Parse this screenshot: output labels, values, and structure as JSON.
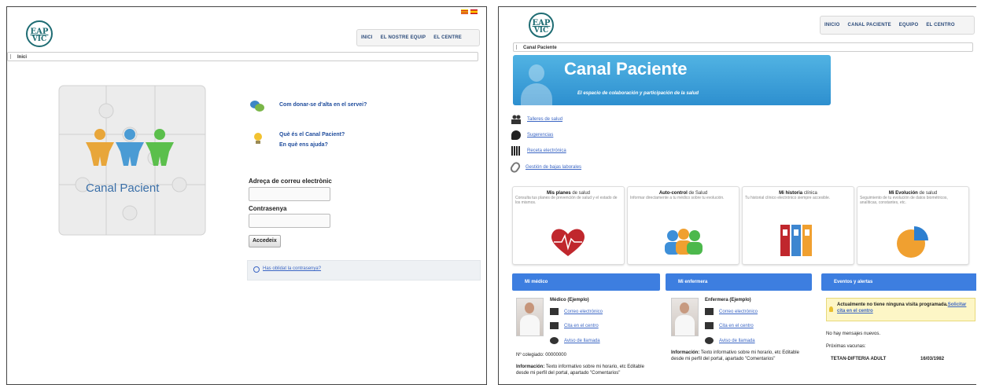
{
  "left": {
    "logo": {
      "line1": "EAP",
      "line2": "VIC"
    },
    "flags": [
      "catalan-flag",
      "spanish-flag"
    ],
    "nav": [
      "INICI",
      "EL NOSTRE EQUIP",
      "EL CENTRE"
    ],
    "breadcrumb": "Inici",
    "puzzle_text": "Canal Pacient",
    "links": [
      {
        "label": "Com donar-se d'alta en el servei?",
        "icon": "chat-bubbles-icon"
      },
      {
        "label": "Què és el Canal Pacient?",
        "icon": "lightbulb-icon"
      },
      {
        "label": "En què ens ajuda?",
        "icon": ""
      }
    ],
    "email_label": "Adreça de correu electrònic",
    "password_label": "Contrasenya",
    "login_button": "Accedeix",
    "forgot_link": "Has oblidat la contrasenya?"
  },
  "right": {
    "logo": {
      "line1": "EAP",
      "line2": "VIC"
    },
    "nav": [
      "INICIO",
      "CANAL PACIENTE",
      "EQUIPO",
      "EL CENTRO"
    ],
    "breadcrumb": "Canal Paciente",
    "banner_title": "Canal Paciente",
    "banner_subtitle": "El espacio de colaboración y participación de la salud",
    "side_links": [
      {
        "label": "Talleres de salud",
        "icon": "people-icon"
      },
      {
        "label": "Sugerencias",
        "icon": "speech-bubble-icon"
      },
      {
        "label": "Receta electrónica",
        "icon": "barcode-icon"
      },
      {
        "label": "Gestión de bajas laborales",
        "icon": "paperclip-icon"
      }
    ],
    "cards": [
      {
        "title_bold": "Mis planes",
        "title_rest": " de salud",
        "desc": "Consulta tus planes de prevención de salud y el estado de los mismos."
      },
      {
        "title_bold": "Auto-control",
        "title_rest": " de Salud",
        "desc": "Informar directamente a tu médico sobre tu evolución."
      },
      {
        "title_bold": "Mi historia",
        "title_rest": " clínica",
        "desc": "Tu historial clínico electrónico siempre accesible."
      },
      {
        "title_bold": "Mi Evolución",
        "title_rest": " de salud",
        "desc": "Seguimiento de tu evolución de datos biométricos, analíticas, constantes, etc."
      }
    ],
    "sections": {
      "doctor": "Mi médico",
      "nurse": "Mi enfermera",
      "events": "Eventos y alertas"
    },
    "doctor": {
      "name": "Médico (Ejemplo)",
      "email": "Correo electrónico",
      "appointment": "Cita en el centro",
      "call": "Aviso de llamada",
      "collegiate": "Nº colegiado: 00000000",
      "info_label": "Información:",
      "info_text": " Texto informativo sobre mi horario, etc Editable desde mi perfil del portal, apartado \"Comentarios\""
    },
    "nurse": {
      "name": "Enfermera (Ejemplo)",
      "email": "Correo electrónico",
      "appointment": "Cita en el centro",
      "call": "Aviso de llamada",
      "info_label": "Información:",
      "info_text": " Texto informativo sobre mi horario, etc Editable desde mi perfil del portal, apartado \"Comentarios\""
    },
    "events": {
      "alert_text": "Actualmente no tiene ninguna visita programada.",
      "alert_link": "Solicitar cita en el centro",
      "no_messages": "No hay mensajes nuevos.",
      "vaccines_label": "Próximas vacunas:",
      "vaccine_name": "TETAN-DIFTERIA ADULT",
      "vaccine_date": "16/03/1982"
    }
  }
}
